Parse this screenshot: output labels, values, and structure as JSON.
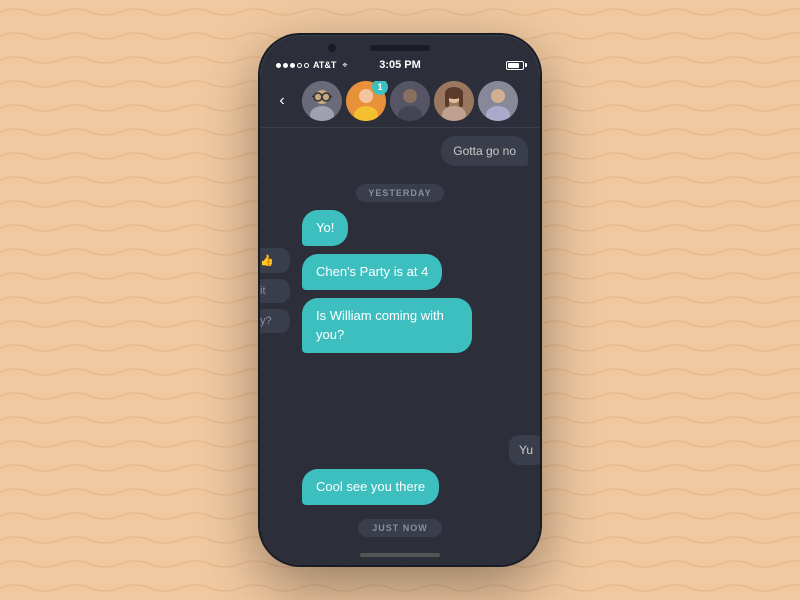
{
  "background": {
    "color": "#f0c9a0"
  },
  "phone": {
    "status_bar": {
      "dots_filled": 3,
      "dots_empty": 2,
      "carrier": "AT&T",
      "wifi": "▾",
      "time": "3:05 PM",
      "battery_level": 80
    },
    "header": {
      "back_label": "‹",
      "avatars": [
        {
          "id": 1,
          "emoji": "👓",
          "has_badge": false,
          "badge_count": 0
        },
        {
          "id": 2,
          "emoji": "🧑",
          "has_badge": true,
          "badge_count": 1
        },
        {
          "id": 3,
          "emoji": "👤",
          "has_badge": false,
          "badge_count": 0
        },
        {
          "id": 4,
          "emoji": "👩",
          "has_badge": false,
          "badge_count": 0
        },
        {
          "id": 5,
          "emoji": "👤",
          "has_badge": false,
          "badge_count": 0
        }
      ]
    },
    "messages": {
      "partial_top_right": "Gotta go no",
      "date_divider": "YESTERDAY",
      "bubbles_sent": [
        {
          "id": 1,
          "text": "Yo!"
        },
        {
          "id": 2,
          "text": "Chen's Party is at 4"
        },
        {
          "id": 3,
          "text": "Is William coming with you?"
        }
      ],
      "partial_left_top": "👍",
      "partial_left_mid": "it",
      "partial_left_bot": "y?",
      "partial_right_mid": "Yu",
      "bubble_last": "Cool see you there",
      "timestamp": "JUST NOW"
    }
  }
}
